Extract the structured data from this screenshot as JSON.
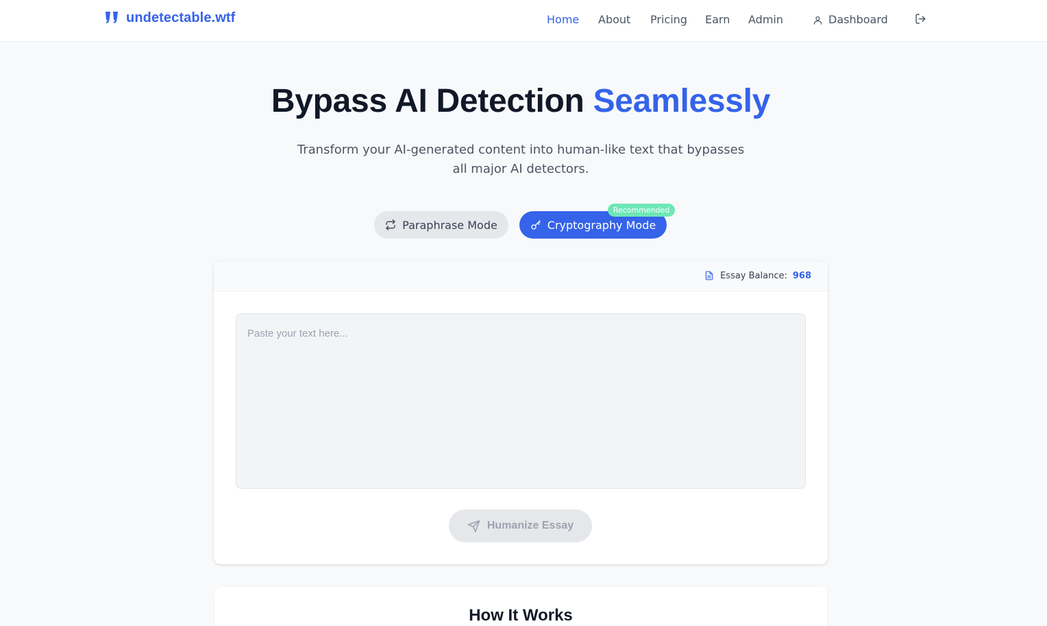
{
  "header": {
    "logo_text": "undetectable.wtf",
    "nav": [
      {
        "label": "Home",
        "active": true
      },
      {
        "label": "About",
        "active": false
      },
      {
        "label": "Pricing",
        "active": false
      },
      {
        "label": "Earn",
        "active": false
      },
      {
        "label": "Admin",
        "active": false
      }
    ],
    "dashboard_label": "Dashboard",
    "dashboard_icon": "user-icon",
    "logout_icon": "logout-icon"
  },
  "hero": {
    "title_main": "Bypass AI Detection",
    "title_accent": "Seamlessly",
    "subtitle": "Transform your AI-generated content into human-like text that bypasses all major AI detectors."
  },
  "modes": {
    "paraphrase_label": "Paraphrase Mode",
    "paraphrase_icon": "swap-icon",
    "crypto_label": "Cryptography Mode",
    "crypto_icon": "key-icon",
    "selected": "crypto",
    "recommended_badge": "Recommended"
  },
  "editor": {
    "balance_label": "Essay Balance:",
    "balance_value": "968",
    "balance_icon": "document-icon",
    "placeholder": "Paste your text here...",
    "value": "",
    "submit_label": "Humanize Essay",
    "submit_icon": "send-icon",
    "submit_disabled": true
  },
  "how_it_works": {
    "title": "How It Works"
  },
  "colors": {
    "accent": "#3563e9",
    "background": "#f8f9fb",
    "badge": "#6ee7b7"
  }
}
